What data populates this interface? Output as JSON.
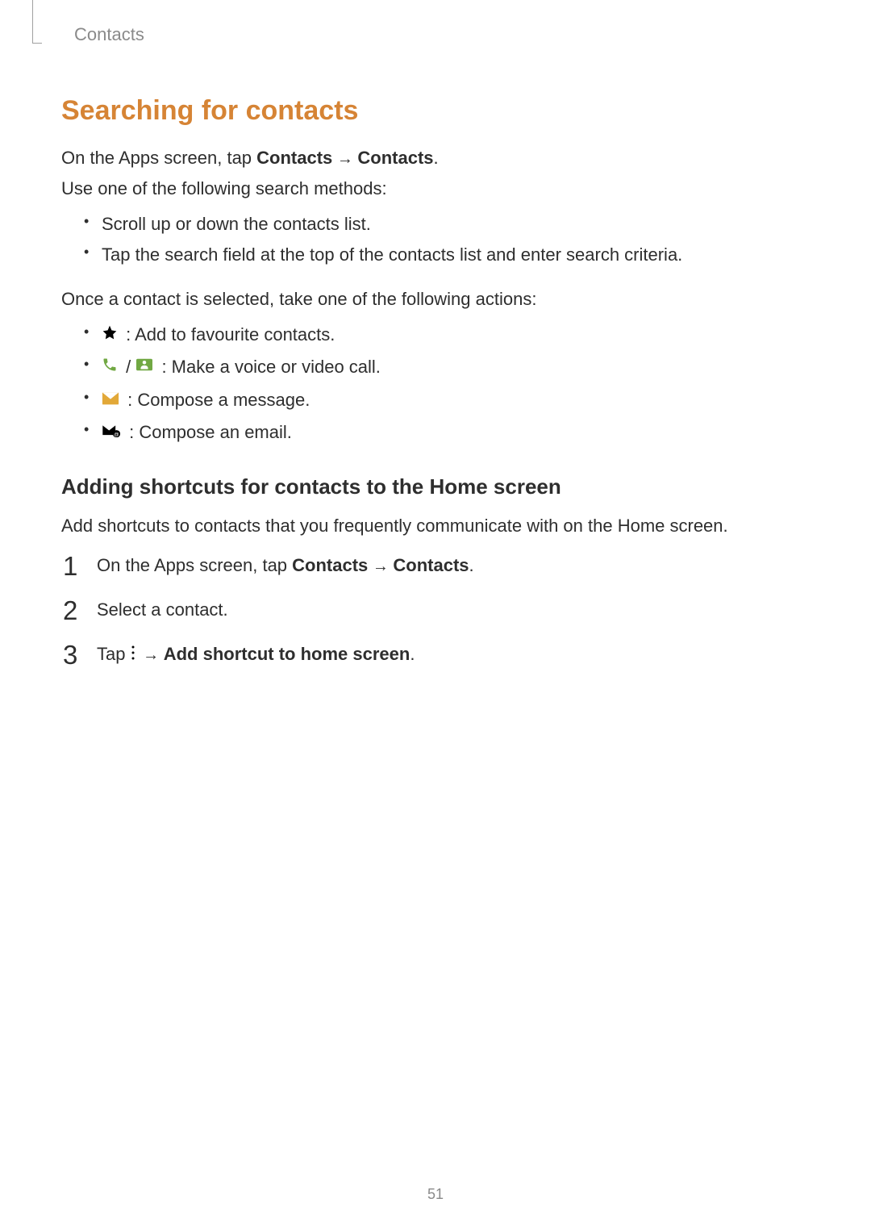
{
  "header": {
    "breadcrumb": "Contacts"
  },
  "section_title": "Searching for contacts",
  "intro": {
    "line1_pre": "On the Apps screen, tap ",
    "line1_b1": "Contacts",
    "line1_mid": " → ",
    "line1_b2": "Contacts",
    "line1_end": ".",
    "line2": "Use one of the following search methods:"
  },
  "methods": {
    "item1": "Scroll up or down the contacts list.",
    "item2": "Tap the search field at the top of the contacts list and enter search criteria."
  },
  "actions_intro": "Once a contact is selected, take one of the following actions:",
  "actions": {
    "item1_text": " : Add to favourite contacts.",
    "item2_sep": " / ",
    "item2_text": " : Make a voice or video call.",
    "item3_text": " : Compose a message.",
    "item4_text": " : Compose an email."
  },
  "subheading": "Adding shortcuts for contacts to the Home screen",
  "sub_intro": "Add shortcuts to contacts that you frequently communicate with on the Home screen.",
  "steps": {
    "n1": "1",
    "s1_pre": "On the Apps screen, tap ",
    "s1_b1": "Contacts",
    "s1_mid": " → ",
    "s1_b2": "Contacts",
    "s1_end": ".",
    "n2": "2",
    "s2": "Select a contact.",
    "n3": "3",
    "s3_pre": "Tap ",
    "s3_mid": " → ",
    "s3_b": "Add shortcut to home screen",
    "s3_end": "."
  },
  "page_number": "51"
}
